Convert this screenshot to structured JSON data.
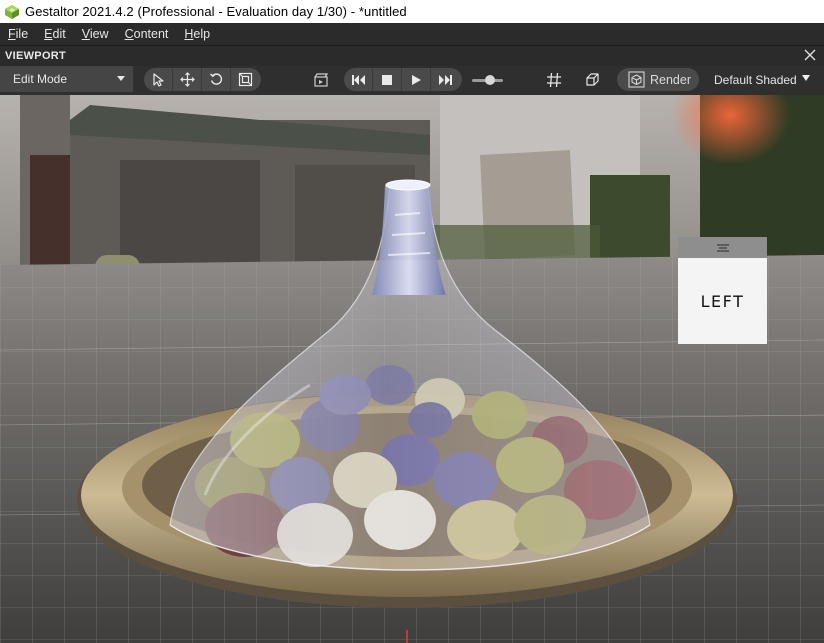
{
  "window": {
    "title": "Gestaltor 2021.4.2 (Professional - Evaluation day 1/30) - *untitled"
  },
  "menu": {
    "items": [
      {
        "label": "File",
        "mnemonic": "F",
        "rest": "ile"
      },
      {
        "label": "Edit",
        "mnemonic": "E",
        "rest": "dit"
      },
      {
        "label": "View",
        "mnemonic": "V",
        "rest": "iew"
      },
      {
        "label": "Content",
        "mnemonic": "C",
        "rest": "ontent"
      },
      {
        "label": "Help",
        "mnemonic": "H",
        "rest": "elp"
      }
    ]
  },
  "panel": {
    "title": "VIEWPORT"
  },
  "toolbar": {
    "mode": "Edit Mode",
    "render_label": "Render",
    "shading_mode": "Default Shaded",
    "tools": [
      "select-arrow-icon",
      "move-icon",
      "rotate-icon",
      "scale-icon"
    ],
    "playback": [
      "skip-back-icon",
      "stop-icon",
      "play-icon",
      "skip-forward-icon"
    ],
    "timeline_slider_value": 0.5
  },
  "viewport": {
    "nav_cube_face": "LEFT"
  },
  "colors": {
    "titlebar_bg": "#ffffff",
    "chrome_bg": "#2b2b2b",
    "button_bg": "#4a4a4a",
    "text": "#e6e6e6"
  }
}
